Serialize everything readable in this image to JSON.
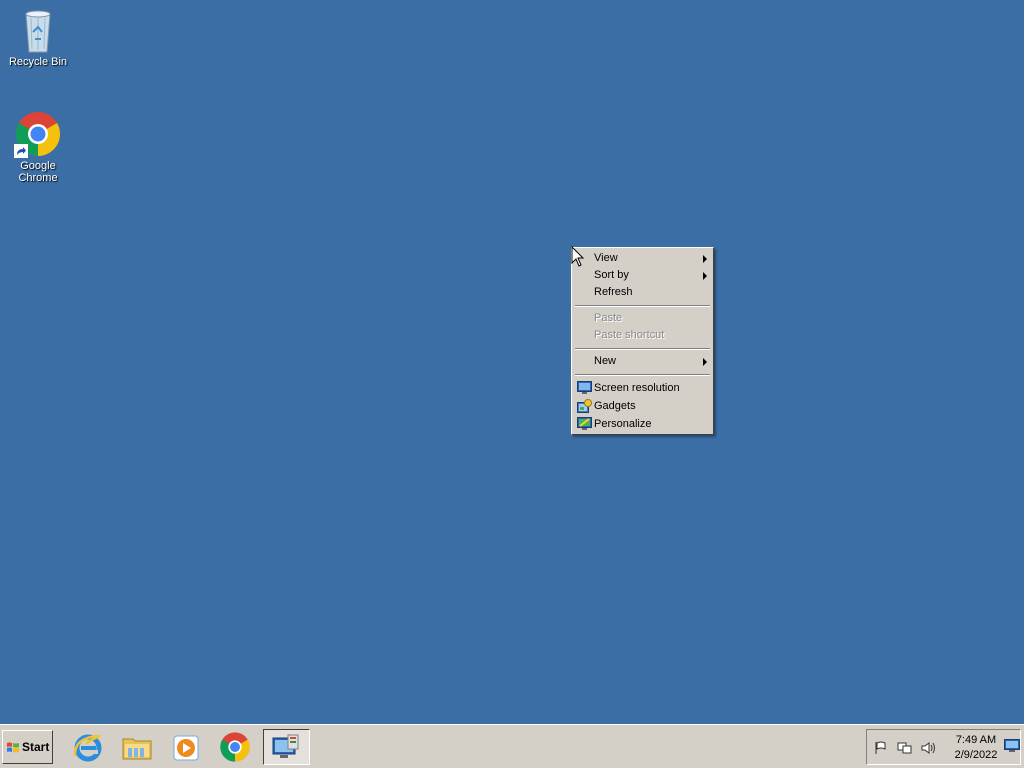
{
  "desktop": {
    "background": "#3a6ea5",
    "icons": [
      {
        "label": "Recycle Bin",
        "icon": "recycle-bin-icon"
      },
      {
        "label": "Google Chrome",
        "icon": "chrome-icon"
      }
    ]
  },
  "context_menu": {
    "items": [
      {
        "label": "View",
        "submenu": true,
        "disabled": false
      },
      {
        "label": "Sort by",
        "submenu": true,
        "disabled": false
      },
      {
        "label": "Refresh",
        "submenu": false,
        "disabled": false
      },
      {
        "label": "Paste",
        "submenu": false,
        "disabled": true
      },
      {
        "label": "Paste shortcut",
        "submenu": false,
        "disabled": true
      },
      {
        "label": "New",
        "submenu": true,
        "disabled": false
      },
      {
        "label": "Screen resolution",
        "icon": "screen-resolution-icon",
        "disabled": false
      },
      {
        "label": "Gadgets",
        "icon": "gadgets-icon",
        "disabled": false
      },
      {
        "label": "Personalize",
        "icon": "personalize-icon",
        "disabled": false
      }
    ]
  },
  "taskbar": {
    "start_label": "Start",
    "pinned": [
      {
        "name": "internet-explorer-icon"
      },
      {
        "name": "windows-explorer-icon"
      },
      {
        "name": "media-player-icon"
      },
      {
        "name": "chrome-icon"
      },
      {
        "name": "server-manager-icon",
        "active": true
      }
    ],
    "tray_icons": [
      "action-center-flag-icon",
      "network-icon",
      "volume-icon"
    ],
    "clock": {
      "time": "7:49 AM",
      "date": "2/9/2022"
    }
  }
}
